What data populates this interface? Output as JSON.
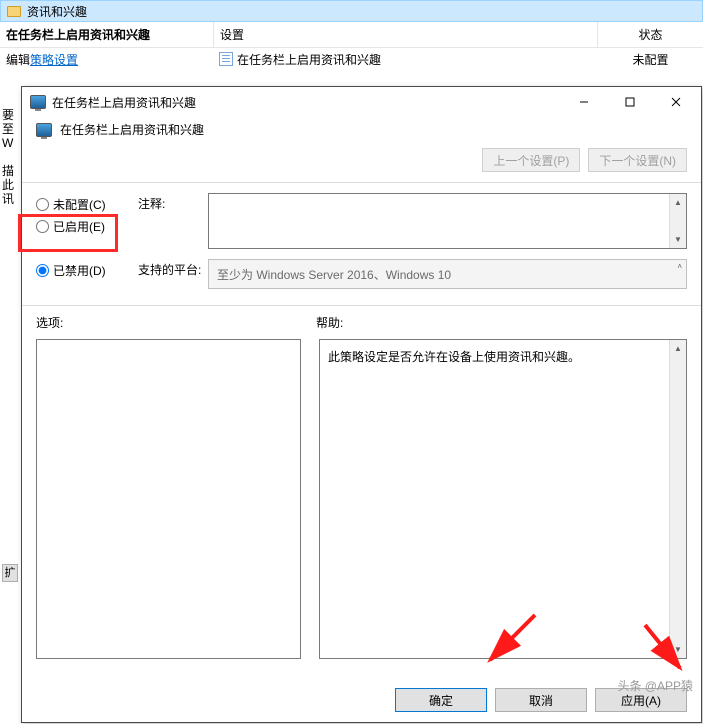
{
  "background": {
    "folder_title": "资讯和兴趣",
    "policy_title": "在任务栏上启用资讯和兴趣",
    "col_setting": "设置",
    "col_state": "状态",
    "row_setting": "在任务栏上启用资讯和兴趣",
    "row_state": "未配置",
    "edit_prefix": "编辑",
    "edit_link": "策略设置",
    "side_text": "要\n至\nW\n\n描\n此\n讯",
    "expand_btn": "扩"
  },
  "dialog": {
    "title": "在任务栏上启用资讯和兴趣",
    "subtitle": "在任务栏上启用资讯和兴趣",
    "prev_btn": "上一个设置(P)",
    "next_btn": "下一个设置(N)",
    "radio_not_configured": "未配置(C)",
    "radio_enabled": "已启用(E)",
    "radio_disabled": "已禁用(D)",
    "label_comment": "注释:",
    "label_platform": "支持的平台:",
    "platform_value": "至少为 Windows Server 2016、Windows 10",
    "label_options": "选项:",
    "label_help": "帮助:",
    "help_text": "此策略设定是否允许在设备上使用资讯和兴趣。",
    "btn_ok": "确定",
    "btn_cancel": "取消",
    "btn_apply": "应用(A)"
  },
  "watermark": "头条 @APP猿"
}
